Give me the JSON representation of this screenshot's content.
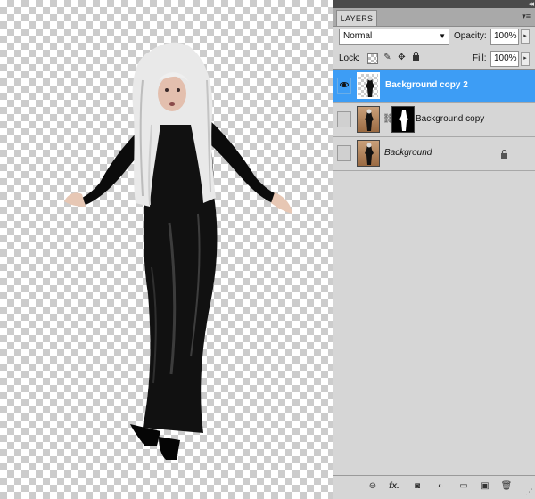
{
  "panel": {
    "tab_label": "LAYERS",
    "blend_mode": "Normal",
    "opacity_label": "Opacity:",
    "opacity_value": "100%",
    "lock_label": "Lock:",
    "fill_label": "Fill:",
    "fill_value": "100%"
  },
  "layers": [
    {
      "name": "Background copy 2",
      "visible": true,
      "selected": true
    },
    {
      "name": "Background copy",
      "visible": false,
      "selected": false,
      "has_mask": true
    },
    {
      "name": "Background",
      "visible": false,
      "selected": false,
      "locked": true,
      "italic": true
    }
  ],
  "icons": {
    "panel_collapse": "double-chevron-left-icon",
    "panel_menu": "panel-menu-icon",
    "bottom": [
      "link-layers-icon",
      "fx-icon",
      "add-mask-icon",
      "adjustment-layer-icon",
      "new-group-icon",
      "new-layer-icon",
      "trash-icon"
    ]
  },
  "colors": {
    "selection": "#3d9df5",
    "panel_bg": "#d6d6d6",
    "checker": "#cccccc"
  }
}
